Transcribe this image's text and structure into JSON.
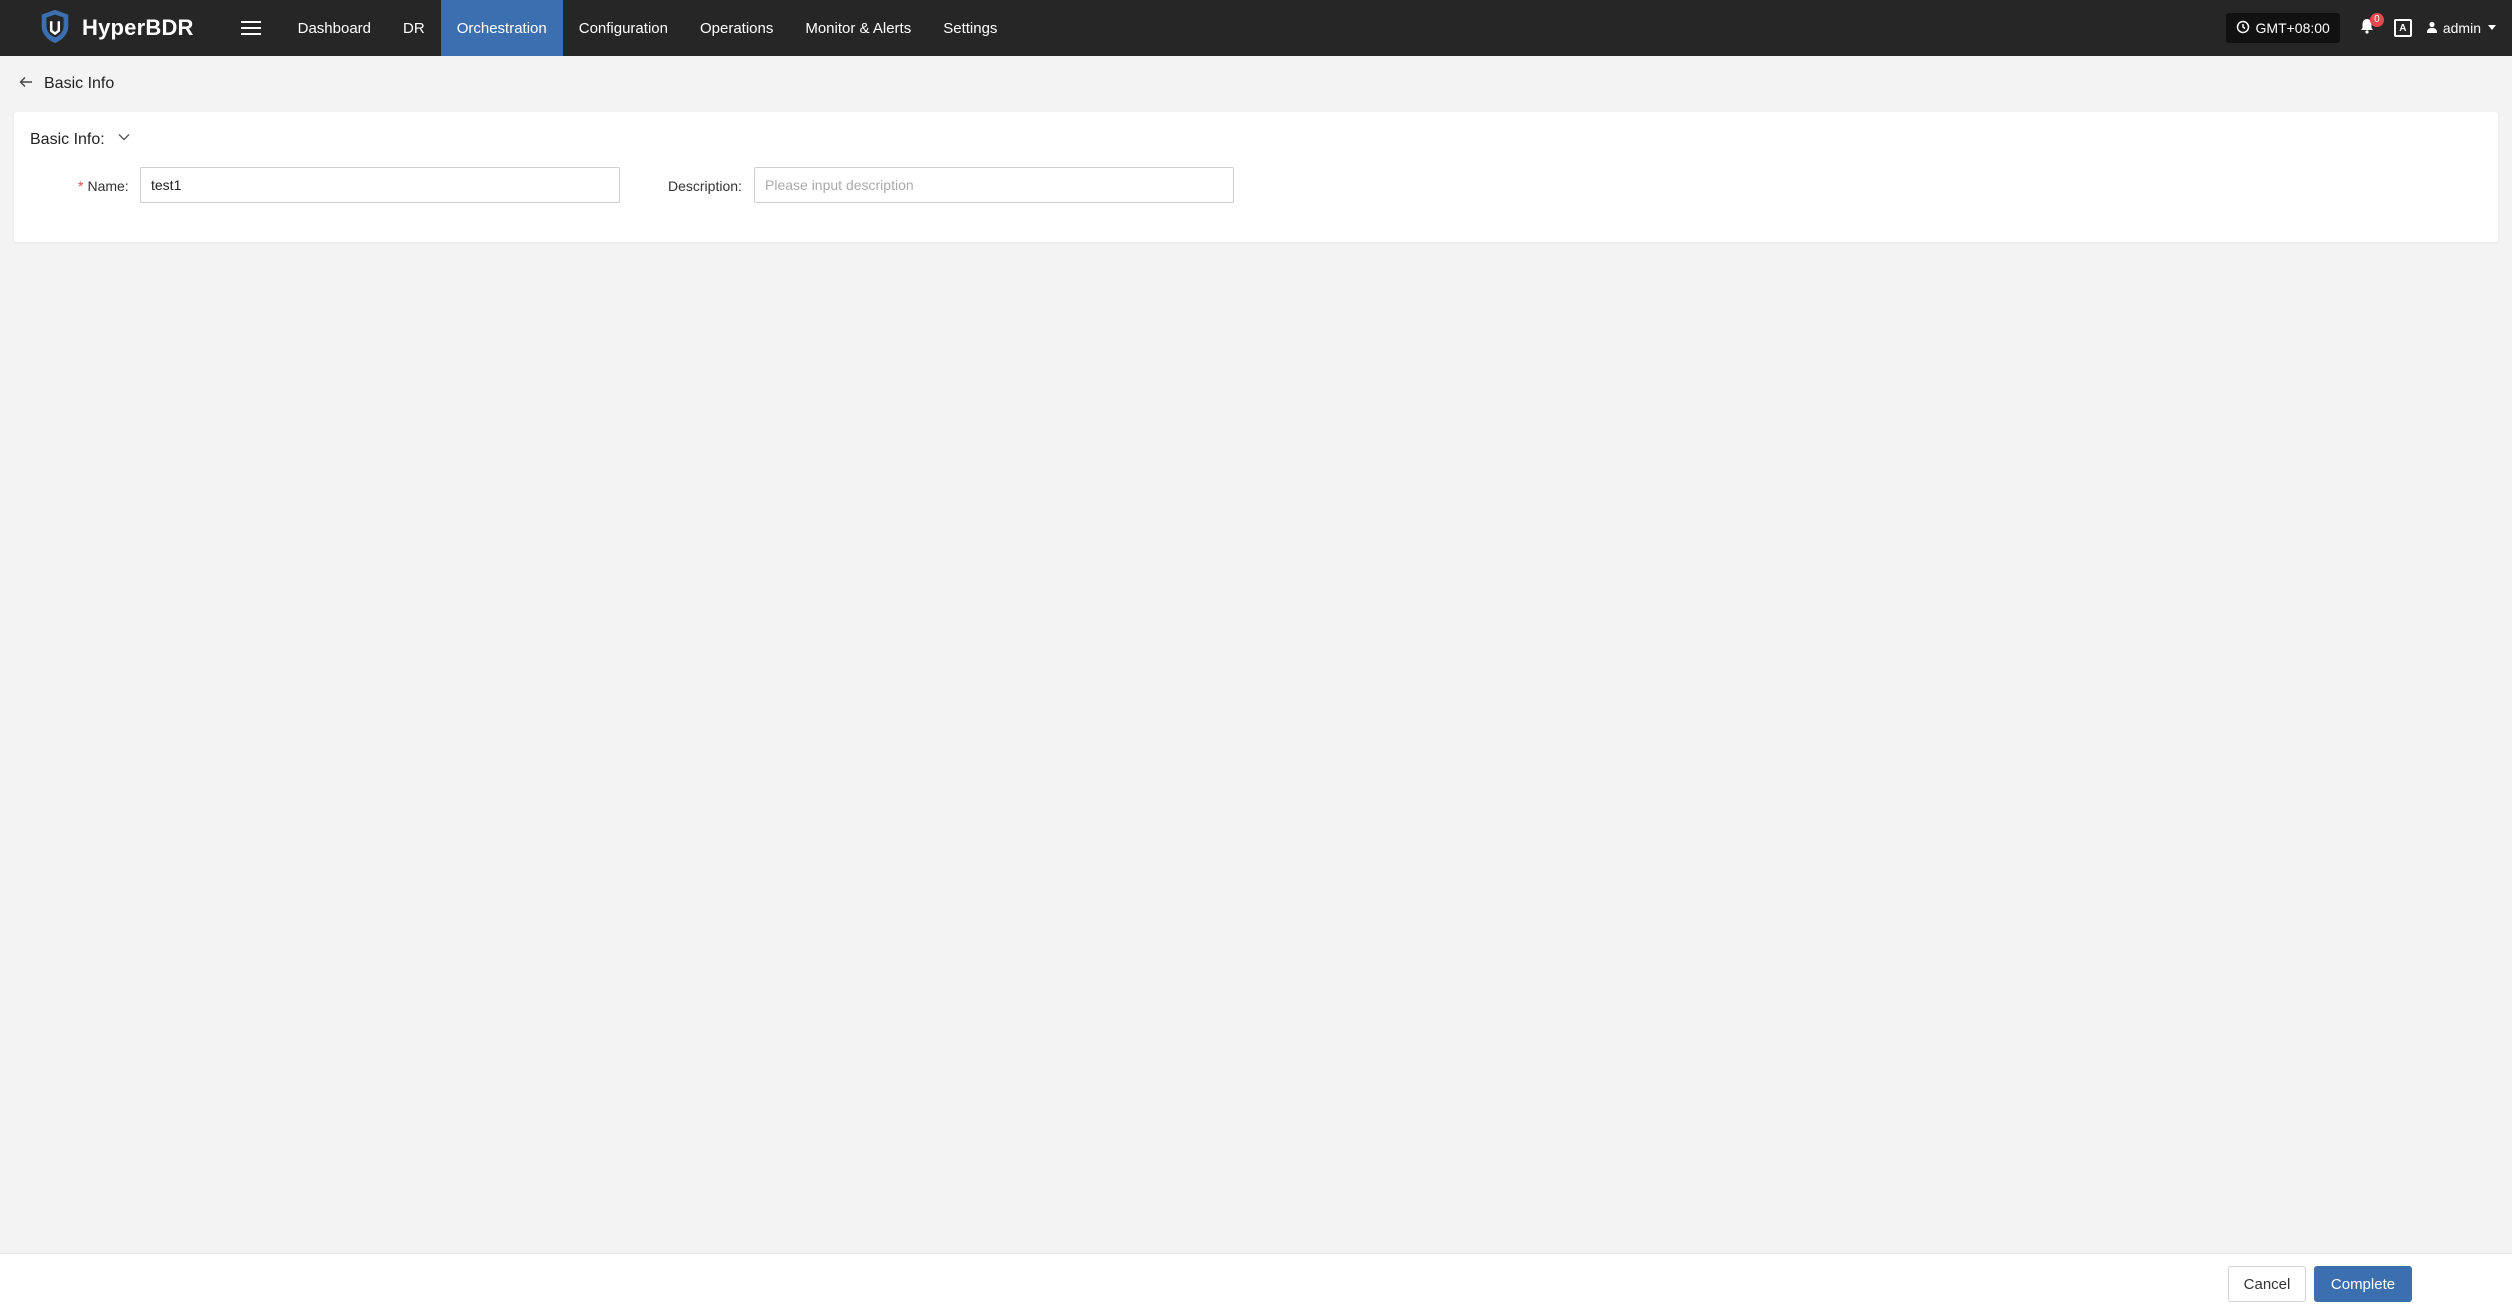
{
  "app": {
    "name": "HyperBDR",
    "brand_color": "#3b6fb0",
    "topbar_color": "#262626"
  },
  "nav": {
    "items": [
      {
        "label": "Dashboard"
      },
      {
        "label": "DR"
      },
      {
        "label": "Orchestration",
        "active": true
      },
      {
        "label": "Configuration"
      },
      {
        "label": "Operations"
      },
      {
        "label": "Monitor & Alerts"
      },
      {
        "label": "Settings"
      }
    ]
  },
  "header_right": {
    "timezone": "GMT+08:00",
    "notification_count": "0",
    "lang_icon_text": "A",
    "user": "admin"
  },
  "breadcrumb": {
    "label": "Basic Info"
  },
  "basic_info": {
    "section_title": "Basic Info:",
    "name_label": "Name:",
    "name_value": "test1",
    "description_label": "Description:",
    "description_placeholder": "Please input description",
    "description_value": ""
  },
  "footer": {
    "cancel_label": "Cancel",
    "complete_label": "Complete"
  }
}
